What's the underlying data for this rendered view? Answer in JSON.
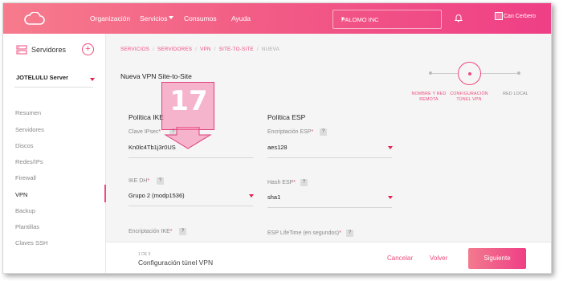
{
  "nav": {
    "items": [
      "Organización",
      "Servicios",
      "Consumos",
      "Ayuda"
    ],
    "org_select": "PALOMO INC",
    "user_name": "Can Cerbero"
  },
  "sidebar": {
    "title": "Servidores",
    "add_label": "+",
    "server_select": "JOTELULU Server",
    "items": [
      "Resumen",
      "Servidores",
      "Discos",
      "Redes/IPs",
      "Firewall",
      "VPN",
      "Backup",
      "Plantillas",
      "Claves SSH"
    ],
    "active_item": "VPN"
  },
  "breadcrumb": {
    "items": [
      "SERVICIOS",
      "SERVIDORES",
      "VPN",
      "SITE-TO-SITE"
    ],
    "current": "NUEVA",
    "separator": "/"
  },
  "page_title": "Nueva VPN Site-to-Site",
  "stepper": {
    "steps": [
      {
        "label_line1": "NOMBRE Y RED",
        "label_line2": "REMOTA"
      },
      {
        "label_line1": "CONFIGURACIÓN",
        "label_line2": "TÚNEL VPN"
      },
      {
        "label_line1": "RED LOCAL",
        "label_line2": ""
      }
    ],
    "active_index": 1
  },
  "ike": {
    "title": "Política IKE",
    "psk_label": "Clave IPsec",
    "psk_value": "Kn0lc4Tb1j3r0US",
    "dh_label": "IKE DH",
    "dh_value": "Grupo 2 (modp1536)",
    "enc_label": "Encriptación IKE"
  },
  "esp": {
    "title": "Política ESP",
    "enc_label": "Encriptación ESP",
    "enc_value": "aes128",
    "hash_label": "Hash ESP",
    "hash_value": "sha1",
    "lifetime_label": "ESP LifeTime (en segundos)"
  },
  "required_mark": "*",
  "help_mark": "?",
  "callout": {
    "number": "17"
  },
  "footer": {
    "step_count": "1 DE 3",
    "step_name": "Configuración túnel VPN",
    "cancel": "Cancelar",
    "back": "Volver",
    "next": "Siguiente"
  },
  "colors": {
    "accent": "#ef4a7c",
    "topbar_start": "#f77b8c",
    "topbar_end": "#ef3f86",
    "caret": "#e0204e"
  }
}
